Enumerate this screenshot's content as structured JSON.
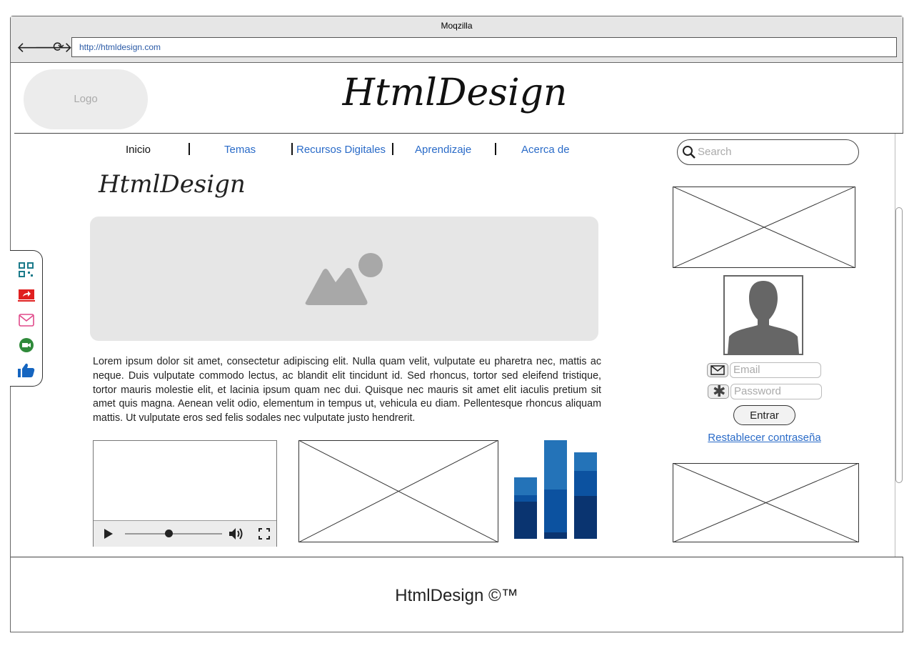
{
  "window": {
    "title": "Moqzilla",
    "url": "http://htmldesign.com"
  },
  "header": {
    "logo": "Logo",
    "site_title": "HtmlDesign"
  },
  "nav": {
    "items": [
      "Inicio",
      "Temas",
      "Recursos Digitales",
      "Aprendizaje",
      "Acerca de"
    ]
  },
  "search": {
    "placeholder": "Search"
  },
  "main": {
    "heading": "HtmlDesign",
    "paragraph": "Lorem ipsum dolor sit amet, consectetur adipiscing elit. Nulla quam velit, vulputate eu pharetra nec, mattis ac neque. Duis vulputate commodo lectus, ac blandit elit tincidunt id. Sed rhoncus, tortor sed eleifend tristique, tortor mauris molestie elit, et lacinia ipsum quam nec dui. Quisque nec mauris sit amet elit iaculis pretium sit amet quis magna. Aenean velit odio, elementum in tempus ut, vehicula eu diam. Pellentesque rhoncus aliquam mattis. Ut vulputate eros sed felis sodales nec vulputate justo hendrerit."
  },
  "video": {
    "progress": 0.45
  },
  "login": {
    "email_placeholder": "Email",
    "password_placeholder": "Password",
    "submit_label": "Entrar",
    "reset_link": "Restablecer contraseña"
  },
  "sidebar_icons": [
    "qr-code-icon",
    "share-icon",
    "mail-icon",
    "video-call-icon",
    "like-icon"
  ],
  "footer": {
    "text": "HtmlDesign ©™"
  },
  "colors": {
    "link": "#2a6bc8",
    "bar_light": "#2473b8",
    "bar_mid": "#0c52a0",
    "bar_dark": "#0a3470"
  }
}
